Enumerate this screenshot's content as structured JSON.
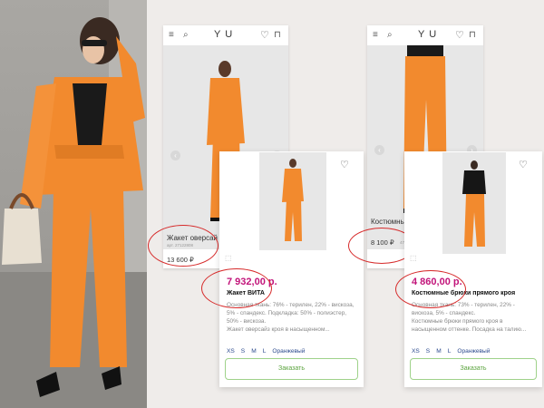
{
  "colors": {
    "accent_price": "#c2147a",
    "order_green": "#5aa33d",
    "orange_suit": "#f28a2e",
    "size_link": "#2b4a8e",
    "annotation_red": "#d62a2a"
  },
  "icons": [
    "menu-icon",
    "search-icon",
    "heart-icon",
    "bag-icon",
    "chevron-left-icon",
    "chevron-right-icon",
    "cube-icon"
  ],
  "screen_left": {
    "logo": "Y U",
    "product_title": "Жакет оверсай",
    "article": "арт. 27122808",
    "price": "13 600 ₽"
  },
  "card_left": {
    "price": "7 932,00 р.",
    "name": "Жакет ВИТА",
    "description": "Основная ткань: 76% - терилен, 22% - вискоза, 5% - спандекс. Подкладка: 50% - полиэстер, 50% - вискоза.",
    "description2": "Жакет оверсайз кроя в насыщенном...",
    "sizes": [
      "XS",
      "S",
      "M",
      "L"
    ],
    "color": "Оранжевый",
    "order_label": "Заказать"
  },
  "screen_right": {
    "logo": "Y U",
    "product_title": "Костюмны",
    "price": "8 100 ₽",
    "price_suffix": "47"
  },
  "card_right": {
    "price": "4 860,00 р.",
    "name": "Костюмные брюки прямого кроя",
    "description": "Основная ткань: 73% - терилен, 22% - вискоза, 5% - спандекс.",
    "description2": "Костюмные брюки прямого кроя в насыщенном оттенке. Посадка на талию...",
    "sizes": [
      "XS",
      "S",
      "M",
      "L"
    ],
    "color": "Оранжевый",
    "order_label": "Заказать"
  }
}
